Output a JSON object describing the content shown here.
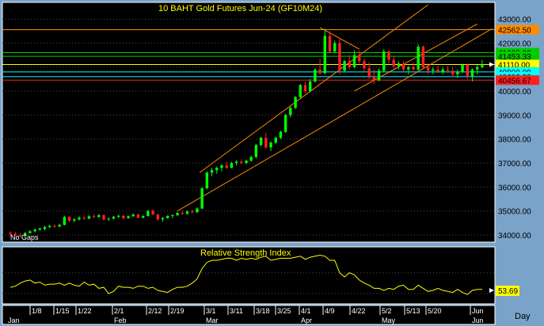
{
  "chart_data": [
    {
      "type": "candlestick",
      "title": "10 BAHT  Gold  Futures  Jun-24  (GF10M24)",
      "note": "No Gaps",
      "ylim": [
        33700,
        43700
      ],
      "y_ticks": [
        34000,
        35000,
        36000,
        37000,
        38000,
        39000,
        40000,
        41000,
        42000,
        43000
      ],
      "y_tick_labels": [
        "34000.00",
        "35000.00",
        "36000.00",
        "37000.00",
        "38000.00",
        "39000.00",
        "40000.00",
        "41000.00",
        "42000.00",
        "43000.00"
      ],
      "price_levels": [
        {
          "value": 42562.5,
          "label": "42562.50",
          "color": "#ff8c00"
        },
        {
          "value": 41605.0,
          "label": "41605.00",
          "color": "#00cc00"
        },
        {
          "value": 41453.33,
          "label": "41453.33",
          "color": "#00cc00"
        },
        {
          "value": 41110.0,
          "label": "41110.00",
          "color": "#ffff00"
        },
        {
          "value": 40800.0,
          "label": "40800.00",
          "color": "#00ffff"
        },
        {
          "value": 40603.33,
          "label": "40603.33",
          "color": "#00ffff"
        },
        {
          "value": 40456.67,
          "label": "40456.67",
          "color": "#ff2020"
        }
      ],
      "candles_ohlc": [
        [
          34100,
          34150,
          33950,
          34050
        ],
        [
          34050,
          34120,
          33980,
          34000
        ],
        [
          33980,
          34070,
          33900,
          33950
        ],
        [
          33950,
          34120,
          33930,
          34080
        ],
        [
          34080,
          34200,
          34050,
          34150
        ],
        [
          34150,
          34260,
          34120,
          34220
        ],
        [
          34220,
          34300,
          34180,
          34270
        ],
        [
          34250,
          34380,
          34200,
          34330
        ],
        [
          34330,
          34420,
          34280,
          34380
        ],
        [
          34380,
          34440,
          34300,
          34350
        ],
        [
          34350,
          34470,
          34320,
          34420
        ],
        [
          34420,
          34800,
          34400,
          34750
        ],
        [
          34750,
          34780,
          34550,
          34600
        ],
        [
          34600,
          34700,
          34530,
          34650
        ],
        [
          34650,
          34780,
          34600,
          34720
        ],
        [
          34720,
          34800,
          34640,
          34680
        ],
        [
          34680,
          34820,
          34650,
          34780
        ],
        [
          34780,
          34850,
          34700,
          34750
        ],
        [
          34750,
          34880,
          34720,
          34820
        ],
        [
          34820,
          34860,
          34600,
          34650
        ],
        [
          34650,
          34720,
          34580,
          34680
        ],
        [
          34680,
          34790,
          34640,
          34760
        ],
        [
          34760,
          34840,
          34700,
          34800
        ],
        [
          34800,
          34830,
          34650,
          34700
        ],
        [
          34700,
          34820,
          34680,
          34780
        ],
        [
          34780,
          34900,
          34750,
          34850
        ],
        [
          34850,
          34880,
          34700,
          34720
        ],
        [
          34720,
          34820,
          34680,
          34790
        ],
        [
          34790,
          35050,
          34760,
          35000
        ],
        [
          35000,
          35080,
          34820,
          34850
        ],
        [
          34850,
          34880,
          34600,
          34650
        ],
        [
          34650,
          34750,
          34550,
          34700
        ],
        [
          34700,
          34820,
          34680,
          34790
        ],
        [
          34790,
          34860,
          34700,
          34820
        ],
        [
          34820,
          34950,
          34790,
          34920
        ],
        [
          34920,
          35000,
          34850,
          34880
        ],
        [
          34880,
          35020,
          34850,
          34980
        ],
        [
          34980,
          35060,
          34900,
          34950
        ],
        [
          34950,
          35150,
          34920,
          35100
        ],
        [
          35100,
          35980,
          35080,
          35950
        ],
        [
          35950,
          36650,
          35900,
          36600
        ],
        [
          36600,
          36800,
          36450,
          36700
        ],
        [
          36700,
          36850,
          36550,
          36800
        ],
        [
          36800,
          36950,
          36650,
          36900
        ],
        [
          36900,
          37050,
          36750,
          36800
        ],
        [
          36800,
          37050,
          36780,
          37000
        ],
        [
          37000,
          37120,
          36900,
          37050
        ],
        [
          37050,
          37150,
          36950,
          37000
        ],
        [
          37000,
          37150,
          36950,
          37100
        ],
        [
          37100,
          37300,
          37050,
          37250
        ],
        [
          37250,
          37800,
          37200,
          37750
        ],
        [
          37750,
          38100,
          37700,
          38050
        ],
        [
          38050,
          38250,
          37600,
          37650
        ],
        [
          37650,
          37900,
          37500,
          37850
        ],
        [
          37850,
          38100,
          37800,
          38050
        ],
        [
          38050,
          38350,
          38000,
          38300
        ],
        [
          38300,
          39050,
          38250,
          39000
        ],
        [
          39000,
          39350,
          38900,
          39300
        ],
        [
          39300,
          39800,
          39250,
          39750
        ],
        [
          39750,
          40300,
          39700,
          40250
        ],
        [
          40250,
          40400,
          39900,
          40000
        ],
        [
          40000,
          40500,
          39950,
          40400
        ],
        [
          40400,
          40950,
          40350,
          40900
        ],
        [
          40900,
          41350,
          40700,
          40750
        ],
        [
          40750,
          42600,
          40700,
          42300
        ],
        [
          42300,
          42500,
          41550,
          41650
        ],
        [
          41650,
          42100,
          41600,
          42000
        ],
        [
          42000,
          42200,
          40700,
          40850
        ],
        [
          40850,
          41300,
          40800,
          41250
        ],
        [
          41250,
          41500,
          40900,
          41000
        ],
        [
          41000,
          41700,
          40950,
          41500
        ],
        [
          41500,
          41700,
          41150,
          41250
        ],
        [
          41250,
          41350,
          40800,
          40950
        ],
        [
          40950,
          41200,
          40500,
          40600
        ],
        [
          40600,
          40900,
          40300,
          40450
        ],
        [
          40450,
          40950,
          40400,
          40850
        ],
        [
          40850,
          41750,
          40800,
          41650
        ],
        [
          41650,
          41700,
          41150,
          41300
        ],
        [
          41300,
          41450,
          40950,
          41050
        ],
        [
          41050,
          41250,
          40900,
          41150
        ],
        [
          41150,
          41250,
          40800,
          40900
        ],
        [
          40900,
          41050,
          40700,
          41000
        ],
        [
          41000,
          41200,
          40850,
          40900
        ],
        [
          40900,
          41950,
          40850,
          41850
        ],
        [
          41850,
          41900,
          40900,
          41000
        ],
        [
          41000,
          41150,
          40700,
          40850
        ],
        [
          40850,
          41000,
          40700,
          40900
        ],
        [
          40900,
          41050,
          40750,
          40800
        ],
        [
          40800,
          41000,
          40700,
          40900
        ],
        [
          40900,
          41050,
          40750,
          40850
        ],
        [
          40850,
          41000,
          40600,
          40700
        ],
        [
          40700,
          40900,
          40550,
          40800
        ],
        [
          40800,
          41150,
          40750,
          41100
        ],
        [
          41100,
          41150,
          40500,
          40600
        ],
        [
          40600,
          40950,
          40400,
          40900
        ],
        [
          40900,
          41100,
          40700,
          41000
        ],
        [
          41000,
          41300,
          40950,
          41110
        ]
      ],
      "trendlines": [
        {
          "color": "#ff8c00",
          "from": [
            38.5,
            36600
          ],
          "to": [
            85,
            43600
          ]
        },
        {
          "color": "#ff8c00",
          "from": [
            34,
            35000
          ],
          "to": [
            98,
            42600
          ]
        },
        {
          "color": "#ff8c00",
          "from": [
            63,
            42650
          ],
          "to": [
            71,
            41750
          ]
        },
        {
          "color": "#ff8c00",
          "from": [
            70,
            40000
          ],
          "to": [
            95,
            42800
          ]
        }
      ],
      "x_tick_labels": [
        "1/8",
        "1/15",
        "1/22",
        "2/1",
        "2/12",
        "2/19",
        "3/1",
        "3/11",
        "3/18",
        "3/25",
        "4/1",
        "4/9",
        "4/22",
        "5/2",
        "5/13",
        "5/20",
        "Jun"
      ],
      "month_labels": [
        "Jan",
        "Feb",
        "Mar",
        "Apr",
        "May",
        "Jun"
      ],
      "x_unit_label": "Day"
    },
    {
      "type": "line",
      "title": "Relative  Strength  Index",
      "last_value_label": "53.69",
      "ylim": [
        40,
        95
      ],
      "values": [
        56,
        57,
        60,
        62,
        63,
        60,
        61,
        58,
        59,
        59,
        60,
        58,
        60,
        58,
        57,
        61,
        58,
        59,
        55,
        56,
        50,
        52,
        57,
        56,
        56,
        55,
        57,
        57,
        55,
        56,
        53,
        52,
        51,
        54,
        56,
        56,
        57,
        60,
        64,
        74,
        80,
        82,
        82,
        83,
        84,
        84,
        82,
        84,
        83,
        84,
        83,
        85,
        86,
        82,
        83,
        84,
        84,
        84,
        85,
        86,
        83,
        85,
        86,
        87,
        86,
        82,
        82,
        70,
        66,
        70,
        68,
        63,
        60,
        58,
        55,
        55,
        53,
        55,
        54,
        57,
        58,
        54,
        54,
        58,
        55,
        52,
        53,
        55,
        53,
        52,
        51,
        54,
        51,
        49,
        53,
        54,
        54
      ]
    }
  ]
}
